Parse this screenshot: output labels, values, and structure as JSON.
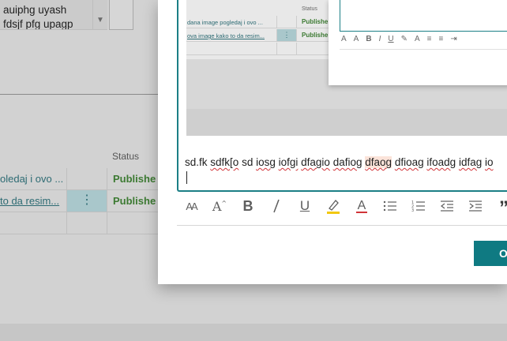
{
  "background": {
    "textbox_lines": [
      "auiphg uyash",
      "fdsjf pfg upagp"
    ],
    "table": {
      "status_header": "Status",
      "rows": [
        {
          "title": "oledaj i ovo ...",
          "status": "Publishe",
          "underlined": false,
          "selected": false
        },
        {
          "title": "to da resim...",
          "status": "Publishe",
          "underlined": true,
          "selected": true
        }
      ],
      "menu_glyph": "⋮"
    }
  },
  "dialog": {
    "embedded_image": {
      "status_header": "Status",
      "rows": [
        {
          "title": "dana image pogledaj i ovo ...",
          "status": "Publishe",
          "underlined": false,
          "selected": false
        },
        {
          "title": "ova image kako to da resim...",
          "status": "Publishe",
          "underlined": true,
          "selected": true
        }
      ],
      "toolbar_glyphs": [
        "A",
        "A",
        "B",
        "I",
        "U",
        "✎",
        "A",
        "≡",
        "≡",
        "⇥"
      ]
    },
    "editor_text": {
      "parts": [
        "sd.fk",
        " ",
        "sdfk[o",
        " sd ",
        "iosg",
        " ",
        "iofgi",
        " ",
        "dfagio",
        " ",
        "dafiog",
        " ",
        "dfaog",
        " ",
        "dfioag",
        " ",
        "ifoadg",
        " ",
        "idfag",
        " ",
        "io"
      ]
    },
    "toolbar": {
      "font_size": "AA",
      "grow_font": "A",
      "bold": "B",
      "italic": "I",
      "underline": "U",
      "highlight": "highlight",
      "font_color": "A",
      "bullets": "bullets",
      "numbering": "numbering",
      "outdent": "outdent",
      "indent": "indent",
      "quote": "”"
    },
    "ok_label": "OK",
    "accent_color": "#0f7a82"
  }
}
